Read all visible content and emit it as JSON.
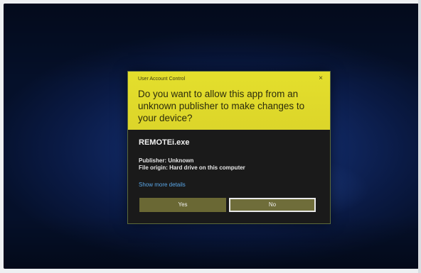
{
  "dialog": {
    "title": "User Account Control",
    "close_glyph": "×",
    "question": "Do you want to allow this app from an unknown publisher to make changes to your device?",
    "app_name": "REMOTEi.exe",
    "publisher": "Publisher: Unknown",
    "file_origin": "File origin: Hard drive on this computer",
    "more_details": "Show more details",
    "yes_label": "Yes",
    "no_label": "No"
  },
  "colors": {
    "header_yellow": "#e4df2c",
    "body_dark": "#1a1a1a",
    "link_blue": "#5aa7e8",
    "desktop_blue": "#122a66"
  },
  "icons": {
    "close": "close-icon"
  }
}
